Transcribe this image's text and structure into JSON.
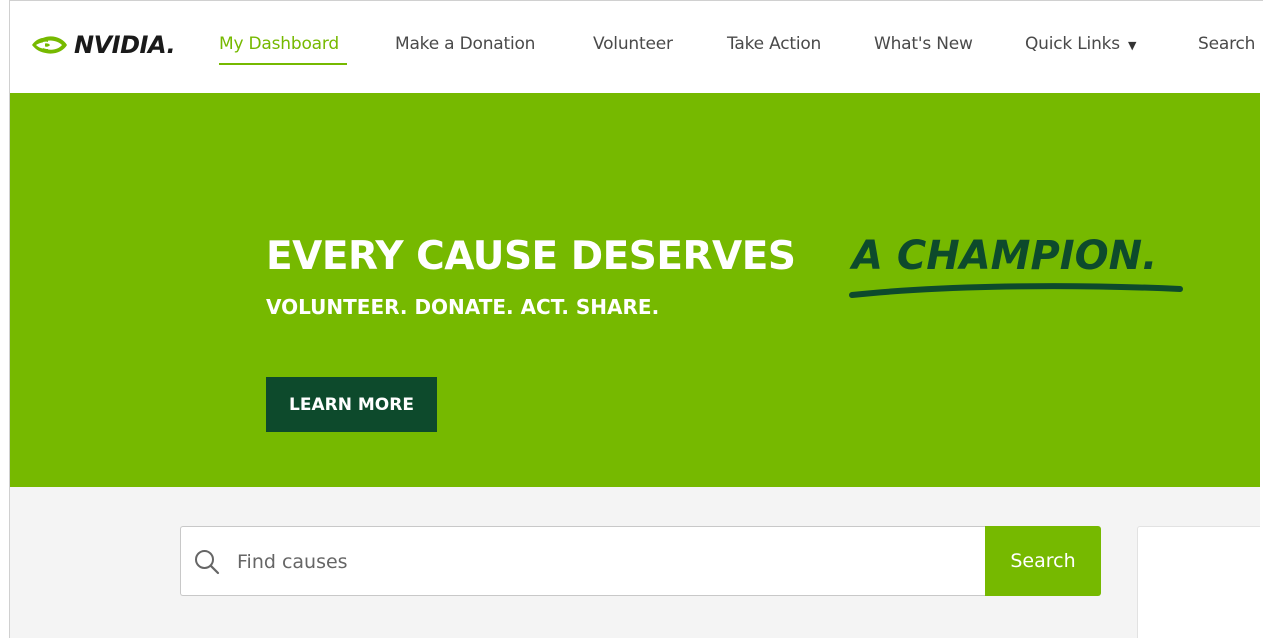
{
  "brand": {
    "logo_text": "NVIDIA.",
    "accent_color": "#76b900",
    "dark_green": "#0d4a2c"
  },
  "nav": {
    "items": [
      {
        "label": "My Dashboard",
        "active": true
      },
      {
        "label": "Make a Donation",
        "active": false
      },
      {
        "label": "Volunteer",
        "active": false
      },
      {
        "label": "Take Action",
        "active": false
      },
      {
        "label": "What's New",
        "active": false
      },
      {
        "label": "Quick Links",
        "active": false,
        "icon": "caret-down-icon"
      },
      {
        "label": "Search",
        "active": false
      }
    ],
    "caret_glyph": "▼"
  },
  "hero": {
    "title": "EVERY CAUSE DESERVES",
    "accent": "A CHAMPION.",
    "subtitle": "VOLUNTEER. DONATE. ACT. SHARE.",
    "button_label": "LEARN MORE"
  },
  "search": {
    "placeholder": "Find causes",
    "value": "",
    "button_label": "Search",
    "icon": "search-icon"
  }
}
